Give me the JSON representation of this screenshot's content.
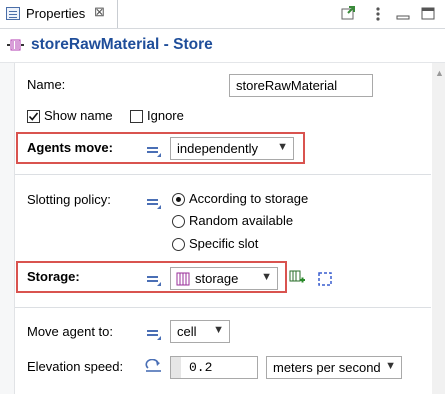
{
  "tab": {
    "label": "Properties",
    "close": "⊠"
  },
  "header": {
    "title": "storeRawMaterial - Store"
  },
  "fields": {
    "name": {
      "label": "Name:",
      "value": "storeRawMaterial"
    },
    "show_name": {
      "label": "Show name",
      "checked": true
    },
    "ignore": {
      "label": "Ignore",
      "checked": false
    },
    "agents_move": {
      "label": "Agents move:",
      "value": "independently"
    },
    "slotting_policy": {
      "label": "Slotting policy:",
      "options": [
        "According to storage",
        "Random available",
        "Specific slot"
      ],
      "selected": "According to storage"
    },
    "storage": {
      "label": "Storage:",
      "value": "storage"
    },
    "move_agent_to": {
      "label": "Move agent to:",
      "value": "cell"
    },
    "elevation_speed": {
      "label": "Elevation speed:",
      "value": "0.2",
      "unit": "meters per second"
    }
  },
  "colors": {
    "title": "#1f4e9a",
    "highlight": "#d9534f",
    "icon": "#4a6fb5"
  }
}
